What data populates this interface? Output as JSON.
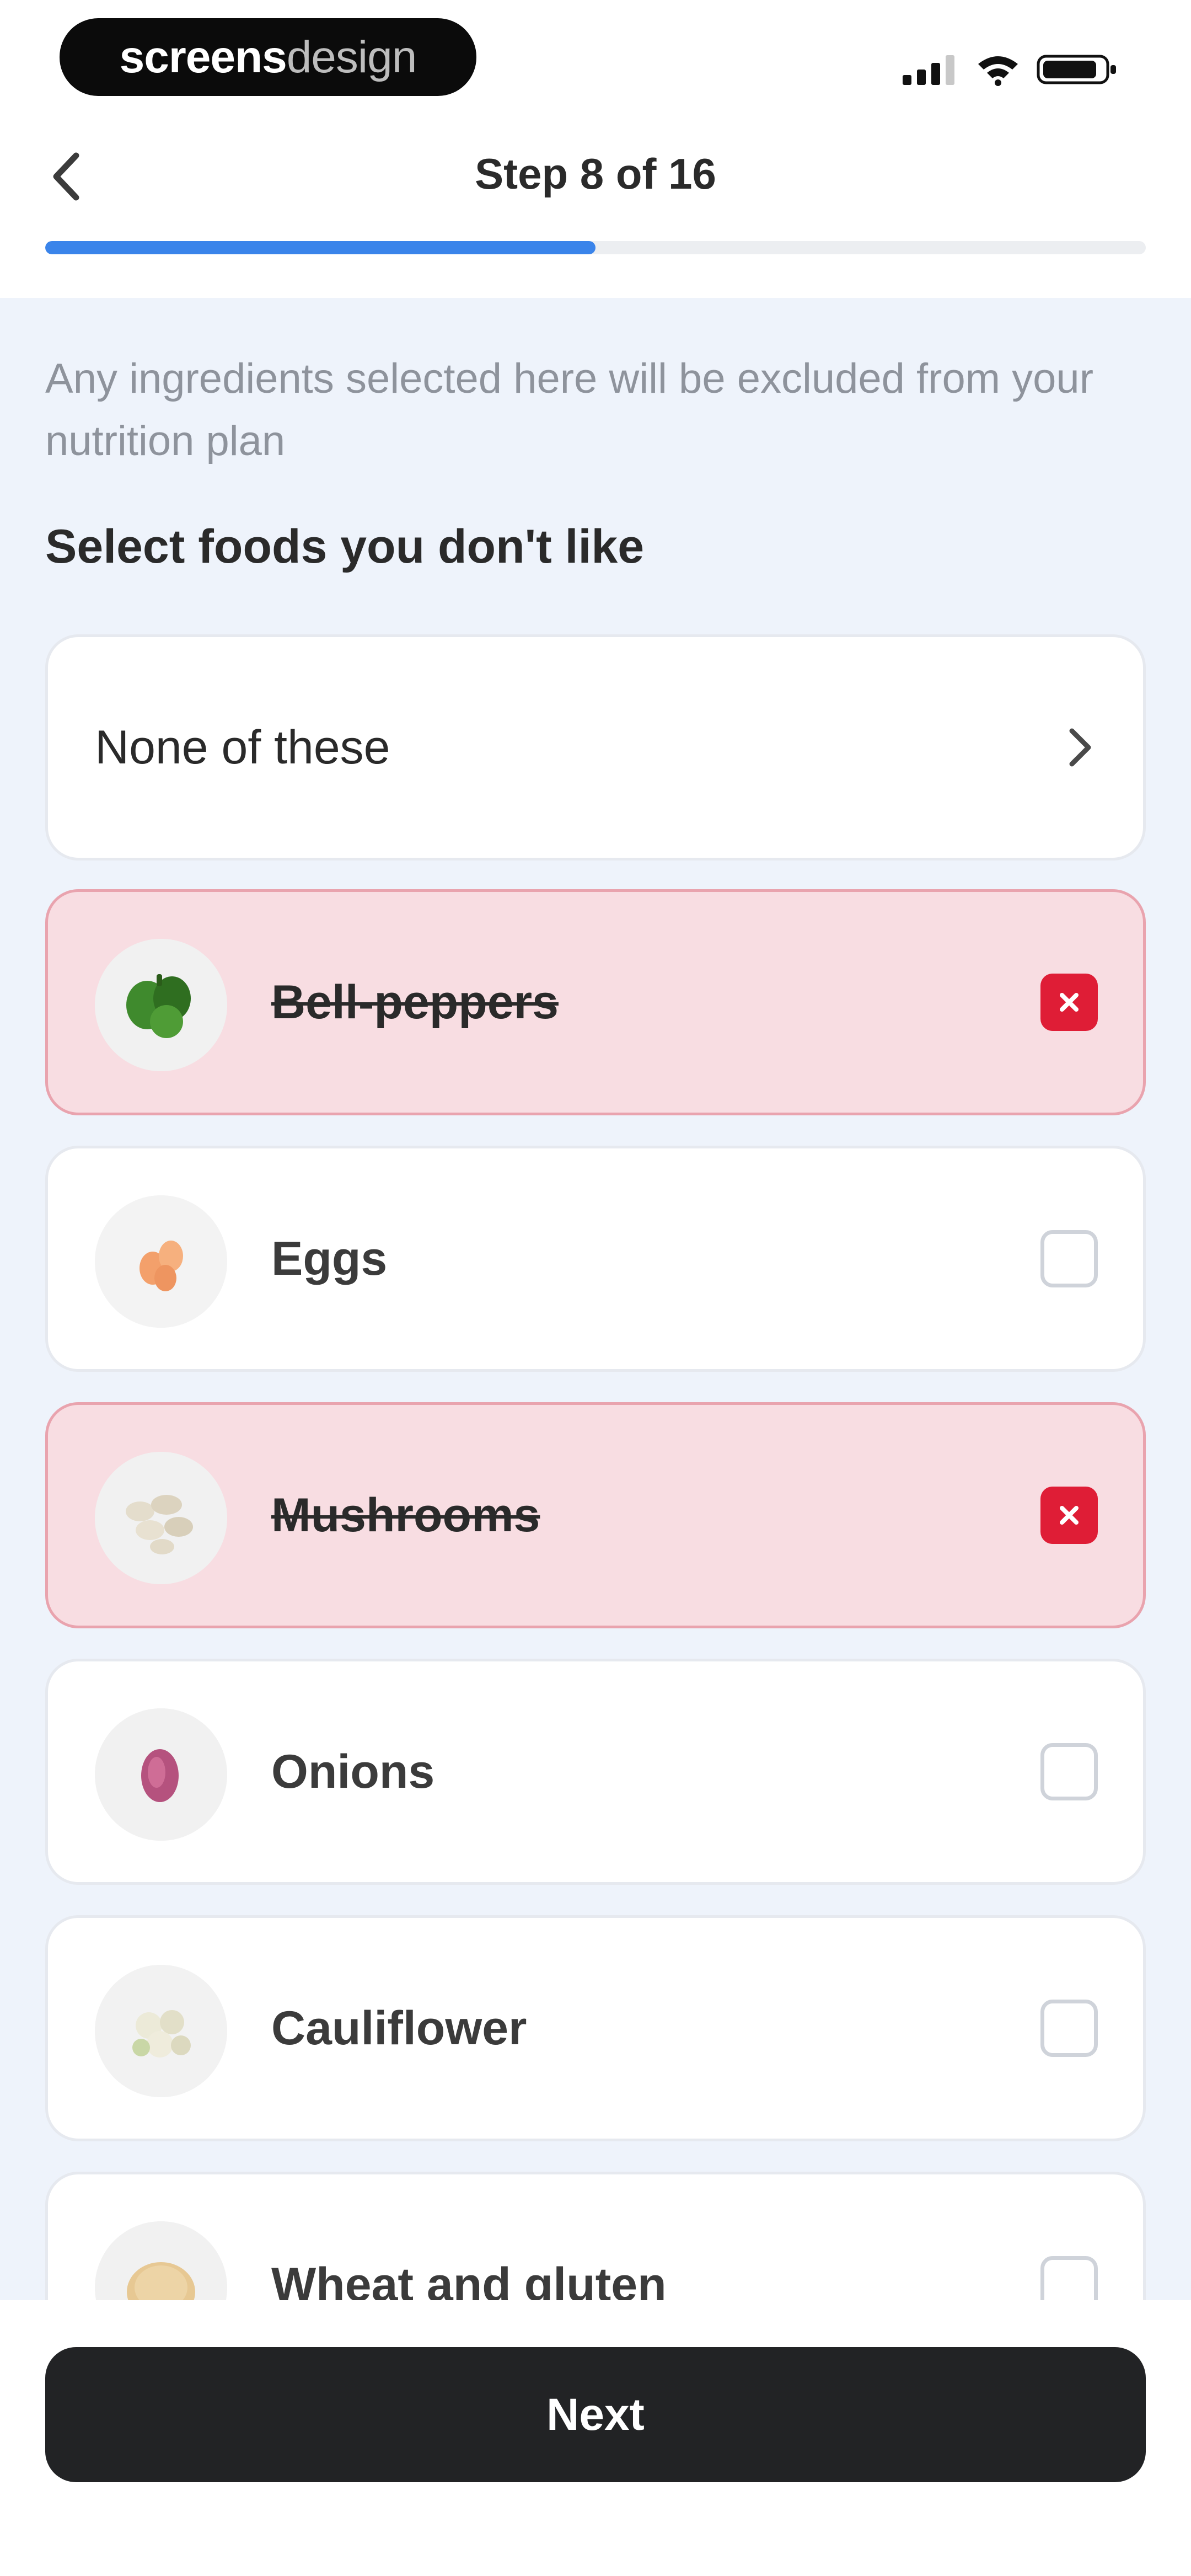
{
  "watermark": {
    "bold": "screens",
    "light": "design"
  },
  "header": {
    "title": "Step 8 of 16",
    "progress": 0.5
  },
  "content": {
    "subtitle": "Any ingredients selected here will be excluded from your nutrition plan",
    "section_title": "Select foods you don't like",
    "none_option": "None of these",
    "foods": [
      {
        "label": "Bell-peppers",
        "selected": true
      },
      {
        "label": "Eggs",
        "selected": false
      },
      {
        "label": "Mushrooms",
        "selected": true
      },
      {
        "label": "Onions",
        "selected": false
      },
      {
        "label": "Cauliflower",
        "selected": false
      },
      {
        "label": "Wheat and gluten",
        "selected": false
      }
    ]
  },
  "footer": {
    "next_label": "Next"
  },
  "colors": {
    "accent": "#3a84ea",
    "selected_bg": "#f8dde2",
    "selected_check": "#df1d36",
    "button": "#222325"
  }
}
